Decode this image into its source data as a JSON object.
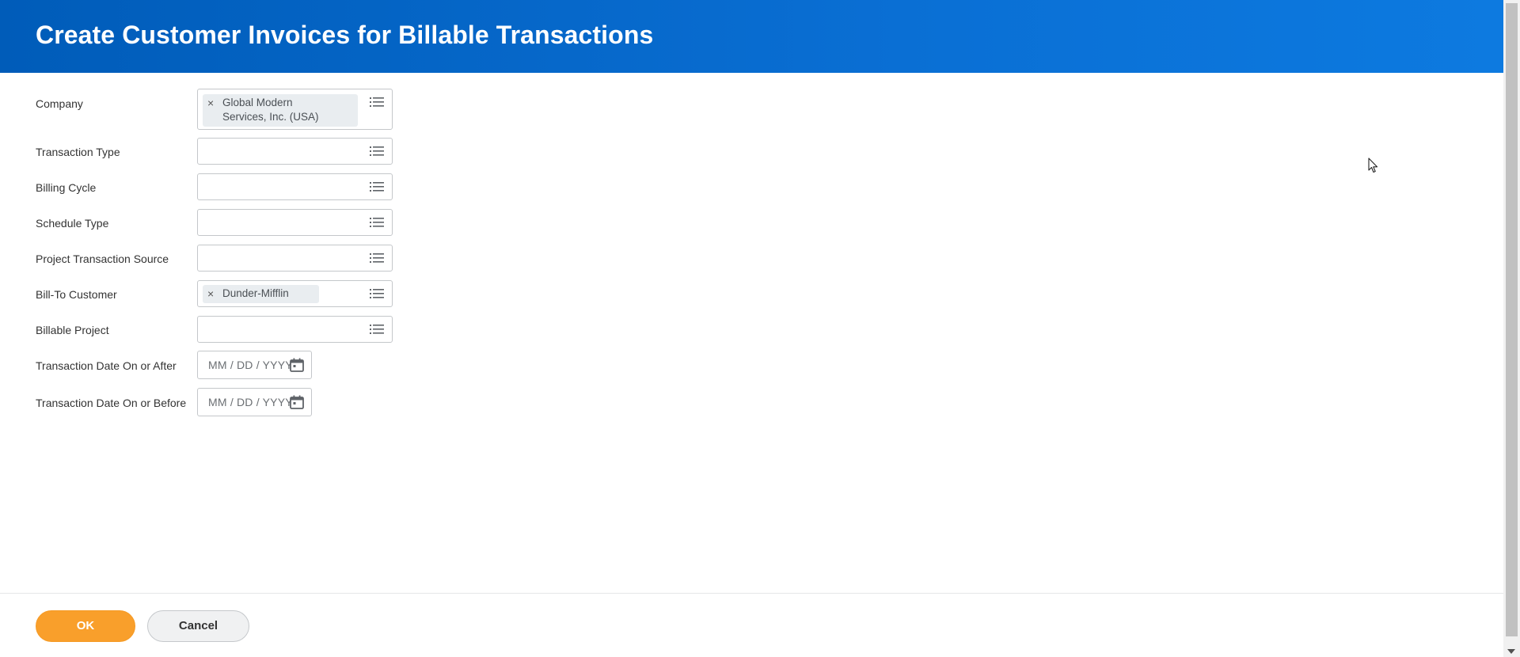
{
  "header": {
    "title": "Create Customer Invoices for Billable Transactions"
  },
  "form": {
    "company": {
      "label": "Company",
      "selected_line1": "Global Modern",
      "selected_line2": "Services, Inc. (USA)"
    },
    "transaction_type": {
      "label": "Transaction Type"
    },
    "billing_cycle": {
      "label": "Billing Cycle"
    },
    "schedule_type": {
      "label": "Schedule Type"
    },
    "project_transaction_source": {
      "label": "Project Transaction Source"
    },
    "bill_to_customer": {
      "label": "Bill-To Customer",
      "selected": "Dunder-Mifflin"
    },
    "billable_project": {
      "label": "Billable Project"
    },
    "date_on_or_after": {
      "label": "Transaction Date On or After",
      "placeholder": "MM / DD / YYYY"
    },
    "date_on_or_before": {
      "label": "Transaction Date On or Before",
      "placeholder": "MM / DD / YYYY"
    },
    "remove_symbol": "×"
  },
  "footer": {
    "ok_label": "OK",
    "cancel_label": "Cancel"
  },
  "colors": {
    "header_blue": "#005cb9",
    "ok_orange": "#f99f2b"
  },
  "icons": {
    "prompt": "list-icon",
    "calendar": "calendar-icon",
    "remove": "close-icon"
  }
}
